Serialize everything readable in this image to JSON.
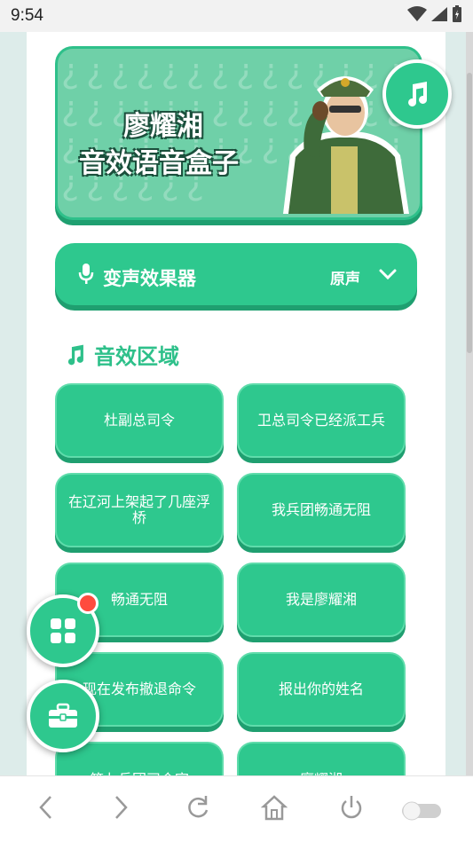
{
  "status_bar": {
    "time": "9:54"
  },
  "banner": {
    "title_line1": "廖耀湘",
    "title_line2": "音效语音盒子"
  },
  "voice_changer": {
    "label": "变声效果器",
    "value": "原声"
  },
  "section": {
    "title": "音效区域"
  },
  "sounds": [
    "杜副总司令",
    "卫总司令已经派工兵",
    "在辽河上架起了几座浮桥",
    "我兵团畅通无阻",
    "畅通无阻",
    "我是廖耀湘",
    "现在发布撤退命令",
    "报出你的姓名",
    "第九兵团司令官",
    "廖耀湘"
  ],
  "colors": {
    "accent": "#2ec88e",
    "accent_dark": "#1f9f70",
    "badge": "#ff4b3e"
  },
  "icons": [
    "music-note-icon",
    "mic-icon",
    "chevron-down-icon",
    "grid-icon",
    "toolbox-icon",
    "back-icon",
    "forward-icon",
    "refresh-icon",
    "home-icon",
    "power-icon",
    "toggle-icon"
  ]
}
